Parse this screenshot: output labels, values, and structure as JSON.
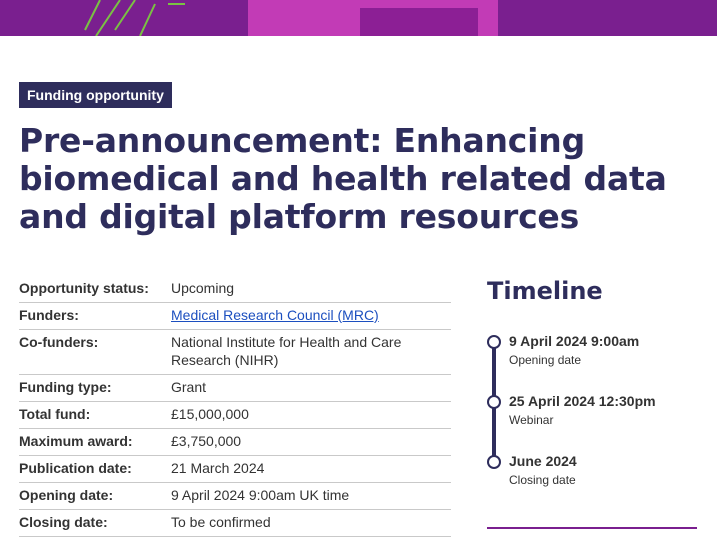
{
  "tag": "Funding opportunity",
  "title": "Pre-announcement: Enhancing biomedical and health related data and digital platform resources",
  "details": [
    {
      "key": "Opportunity status:",
      "value": "Upcoming"
    },
    {
      "key": "Funders:",
      "value": "Medical Research Council (MRC)",
      "link": true
    },
    {
      "key": "Co-funders:",
      "value": "National Institute for Health and Care Research (NIHR)"
    },
    {
      "key": "Funding type:",
      "value": "Grant"
    },
    {
      "key": "Total fund:",
      "value": "£15,000,000"
    },
    {
      "key": "Maximum award:",
      "value": "£3,750,000"
    },
    {
      "key": "Publication date:",
      "value": "21 March 2024"
    },
    {
      "key": "Opening date:",
      "value": "9 April 2024 9:00am UK time"
    },
    {
      "key": "Closing date:",
      "value": "To be confirmed"
    }
  ],
  "timeline": {
    "heading": "Timeline",
    "items": [
      {
        "when": "9 April 2024 9:00am",
        "what": "Opening date"
      },
      {
        "when": "25 April 2024 12:30pm",
        "what": "Webinar"
      },
      {
        "when": "June 2024",
        "what": "Closing date"
      }
    ]
  },
  "colors": {
    "navy": "#2e2d5c",
    "purple": "#7a1f8f",
    "magenta": "#c23bb6",
    "link": "#1c4fbf"
  }
}
